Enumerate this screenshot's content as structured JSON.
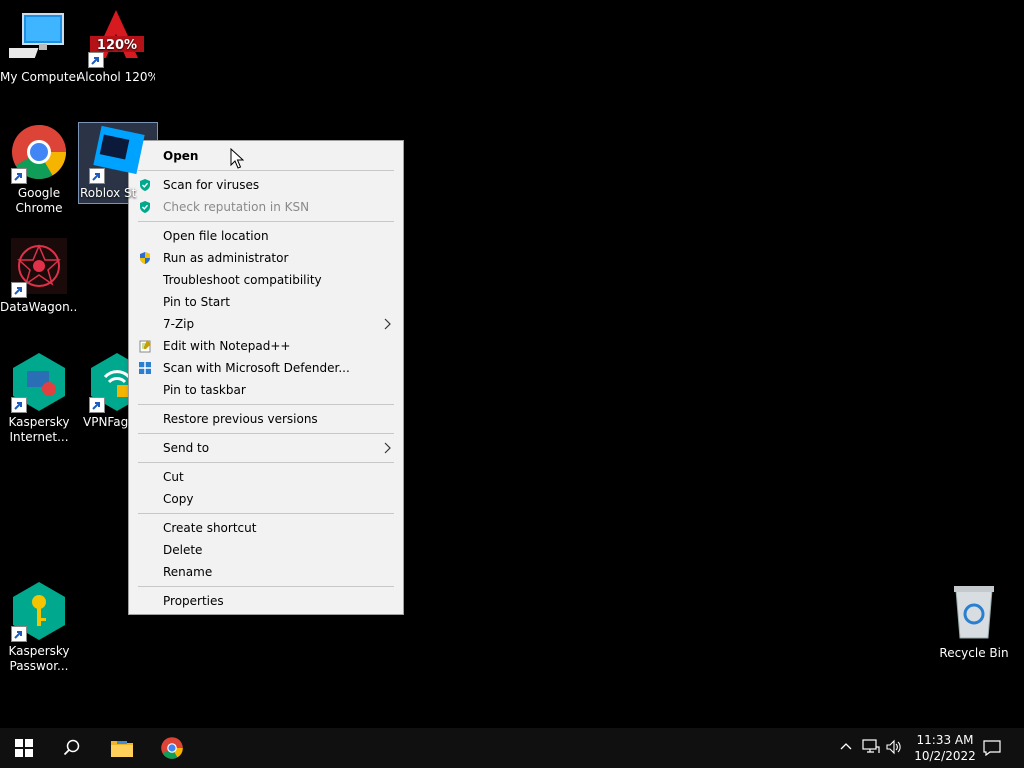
{
  "desktop": {
    "icons": [
      {
        "label": "My Computer"
      },
      {
        "label": "Alcohol 120%",
        "badge": "120%"
      },
      {
        "label": "Google Chrome"
      },
      {
        "label": "Roblox St"
      },
      {
        "label": "DataWagon..."
      },
      {
        "label": "Kaspersky Internet..."
      },
      {
        "label": "VPNFag"
      },
      {
        "label": "Kaspersky Passwor..."
      },
      {
        "label": "Recycle Bin"
      }
    ]
  },
  "context_menu": {
    "items": [
      {
        "label": "Open"
      },
      {
        "label": "Scan for viruses"
      },
      {
        "label": "Check reputation in KSN"
      },
      {
        "label": "Open file location"
      },
      {
        "label": "Run as administrator"
      },
      {
        "label": "Troubleshoot compatibility"
      },
      {
        "label": "Pin to Start"
      },
      {
        "label": "7-Zip"
      },
      {
        "label": "Edit with Notepad++"
      },
      {
        "label": "Scan with Microsoft Defender..."
      },
      {
        "label": "Pin to taskbar"
      },
      {
        "label": "Restore previous versions"
      },
      {
        "label": "Send to"
      },
      {
        "label": "Cut"
      },
      {
        "label": "Copy"
      },
      {
        "label": "Create shortcut"
      },
      {
        "label": "Delete"
      },
      {
        "label": "Rename"
      },
      {
        "label": "Properties"
      }
    ]
  },
  "taskbar": {
    "time": "11:33 AM",
    "date": "10/2/2022"
  },
  "colors": {
    "accent": "#0078d7",
    "kaspersky": "#00a88e",
    "menu_bg": "#f2f2f2"
  }
}
